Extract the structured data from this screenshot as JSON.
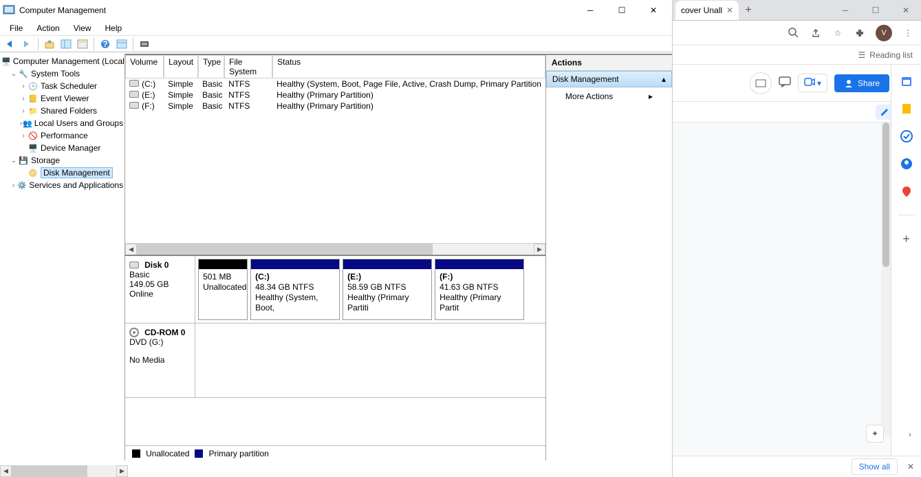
{
  "window": {
    "title": "Computer Management"
  },
  "menus": [
    "File",
    "Action",
    "View",
    "Help"
  ],
  "tree": {
    "root": "Computer Management (Local",
    "system_tools": "System Tools",
    "task_scheduler": "Task Scheduler",
    "event_viewer": "Event Viewer",
    "shared_folders": "Shared Folders",
    "local_users": "Local Users and Groups",
    "performance": "Performance",
    "device_manager": "Device Manager",
    "storage": "Storage",
    "disk_management": "Disk Management",
    "services_apps": "Services and Applications"
  },
  "volumes": {
    "headers": {
      "volume": "Volume",
      "layout": "Layout",
      "type": "Type",
      "filesystem": "File System",
      "status": "Status"
    },
    "rows": [
      {
        "vol": "(C:)",
        "layout": "Simple",
        "type": "Basic",
        "fs": "NTFS",
        "status": "Healthy (System, Boot, Page File, Active, Crash Dump, Primary Partition"
      },
      {
        "vol": "(E:)",
        "layout": "Simple",
        "type": "Basic",
        "fs": "NTFS",
        "status": "Healthy (Primary Partition)"
      },
      {
        "vol": "(F:)",
        "layout": "Simple",
        "type": "Basic",
        "fs": "NTFS",
        "status": "Healthy (Primary Partition)"
      }
    ]
  },
  "disk0": {
    "name": "Disk 0",
    "type": "Basic",
    "size": "149.05 GB",
    "state": "Online",
    "parts": [
      {
        "label": "",
        "size": "501 MB",
        "status": "Unallocated",
        "topcolor": "black"
      },
      {
        "label": "(C:)",
        "size": "48.34 GB NTFS",
        "status": "Healthy (System, Boot,",
        "topcolor": "blue"
      },
      {
        "label": "(E:)",
        "size": "58.59 GB NTFS",
        "status": "Healthy (Primary Partiti",
        "topcolor": "blue"
      },
      {
        "label": "(F:)",
        "size": "41.63 GB NTFS",
        "status": "Healthy (Primary Partit",
        "topcolor": "blue"
      }
    ]
  },
  "cdrom": {
    "name": "CD-ROM 0",
    "type": "DVD (G:)",
    "state": "No Media"
  },
  "legend": {
    "unalloc": "Unallocated",
    "primary": "Primary partition"
  },
  "actions": {
    "title": "Actions",
    "section": "Disk Management",
    "more": "More Actions"
  },
  "browser": {
    "tab_title": "cover Unall",
    "reading_list": "Reading list",
    "share": "Share",
    "show_all": "Show all",
    "avatar_letter": "V"
  }
}
